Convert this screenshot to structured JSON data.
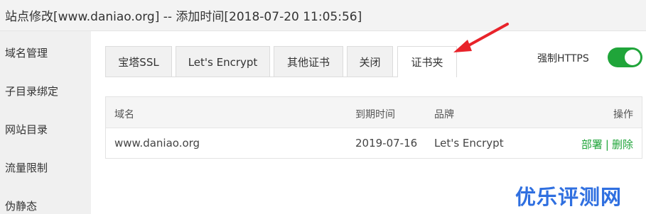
{
  "window": {
    "title": "站点修改[www.daniao.org] -- 添加时间[2018-07-20 11:05:56]"
  },
  "sidebar": {
    "items": [
      {
        "label": "域名管理"
      },
      {
        "label": "子目录绑定"
      },
      {
        "label": "网站目录"
      },
      {
        "label": "流量限制"
      },
      {
        "label": "伪静态"
      }
    ]
  },
  "tabs": [
    {
      "label": "宝塔SSL"
    },
    {
      "label": "Let's Encrypt"
    },
    {
      "label": "其他证书"
    },
    {
      "label": "关闭"
    },
    {
      "label": "证书夹",
      "active": true
    }
  ],
  "force_https": {
    "label": "强制HTTPS",
    "enabled": true
  },
  "cert_table": {
    "columns": [
      "域名",
      "到期时间",
      "品牌",
      "操作"
    ],
    "rows": [
      {
        "domain": "www.daniao.org",
        "expires": "2019-07-16",
        "brand": "Let's Encrypt",
        "deploy": "部署",
        "delete": "删除",
        "separator": "|"
      }
    ]
  },
  "watermark": {
    "text": "优乐评测网"
  },
  "colors": {
    "accent": "#20a53a",
    "annotation": "#e8232a",
    "watermark": "#2f6fe0"
  }
}
